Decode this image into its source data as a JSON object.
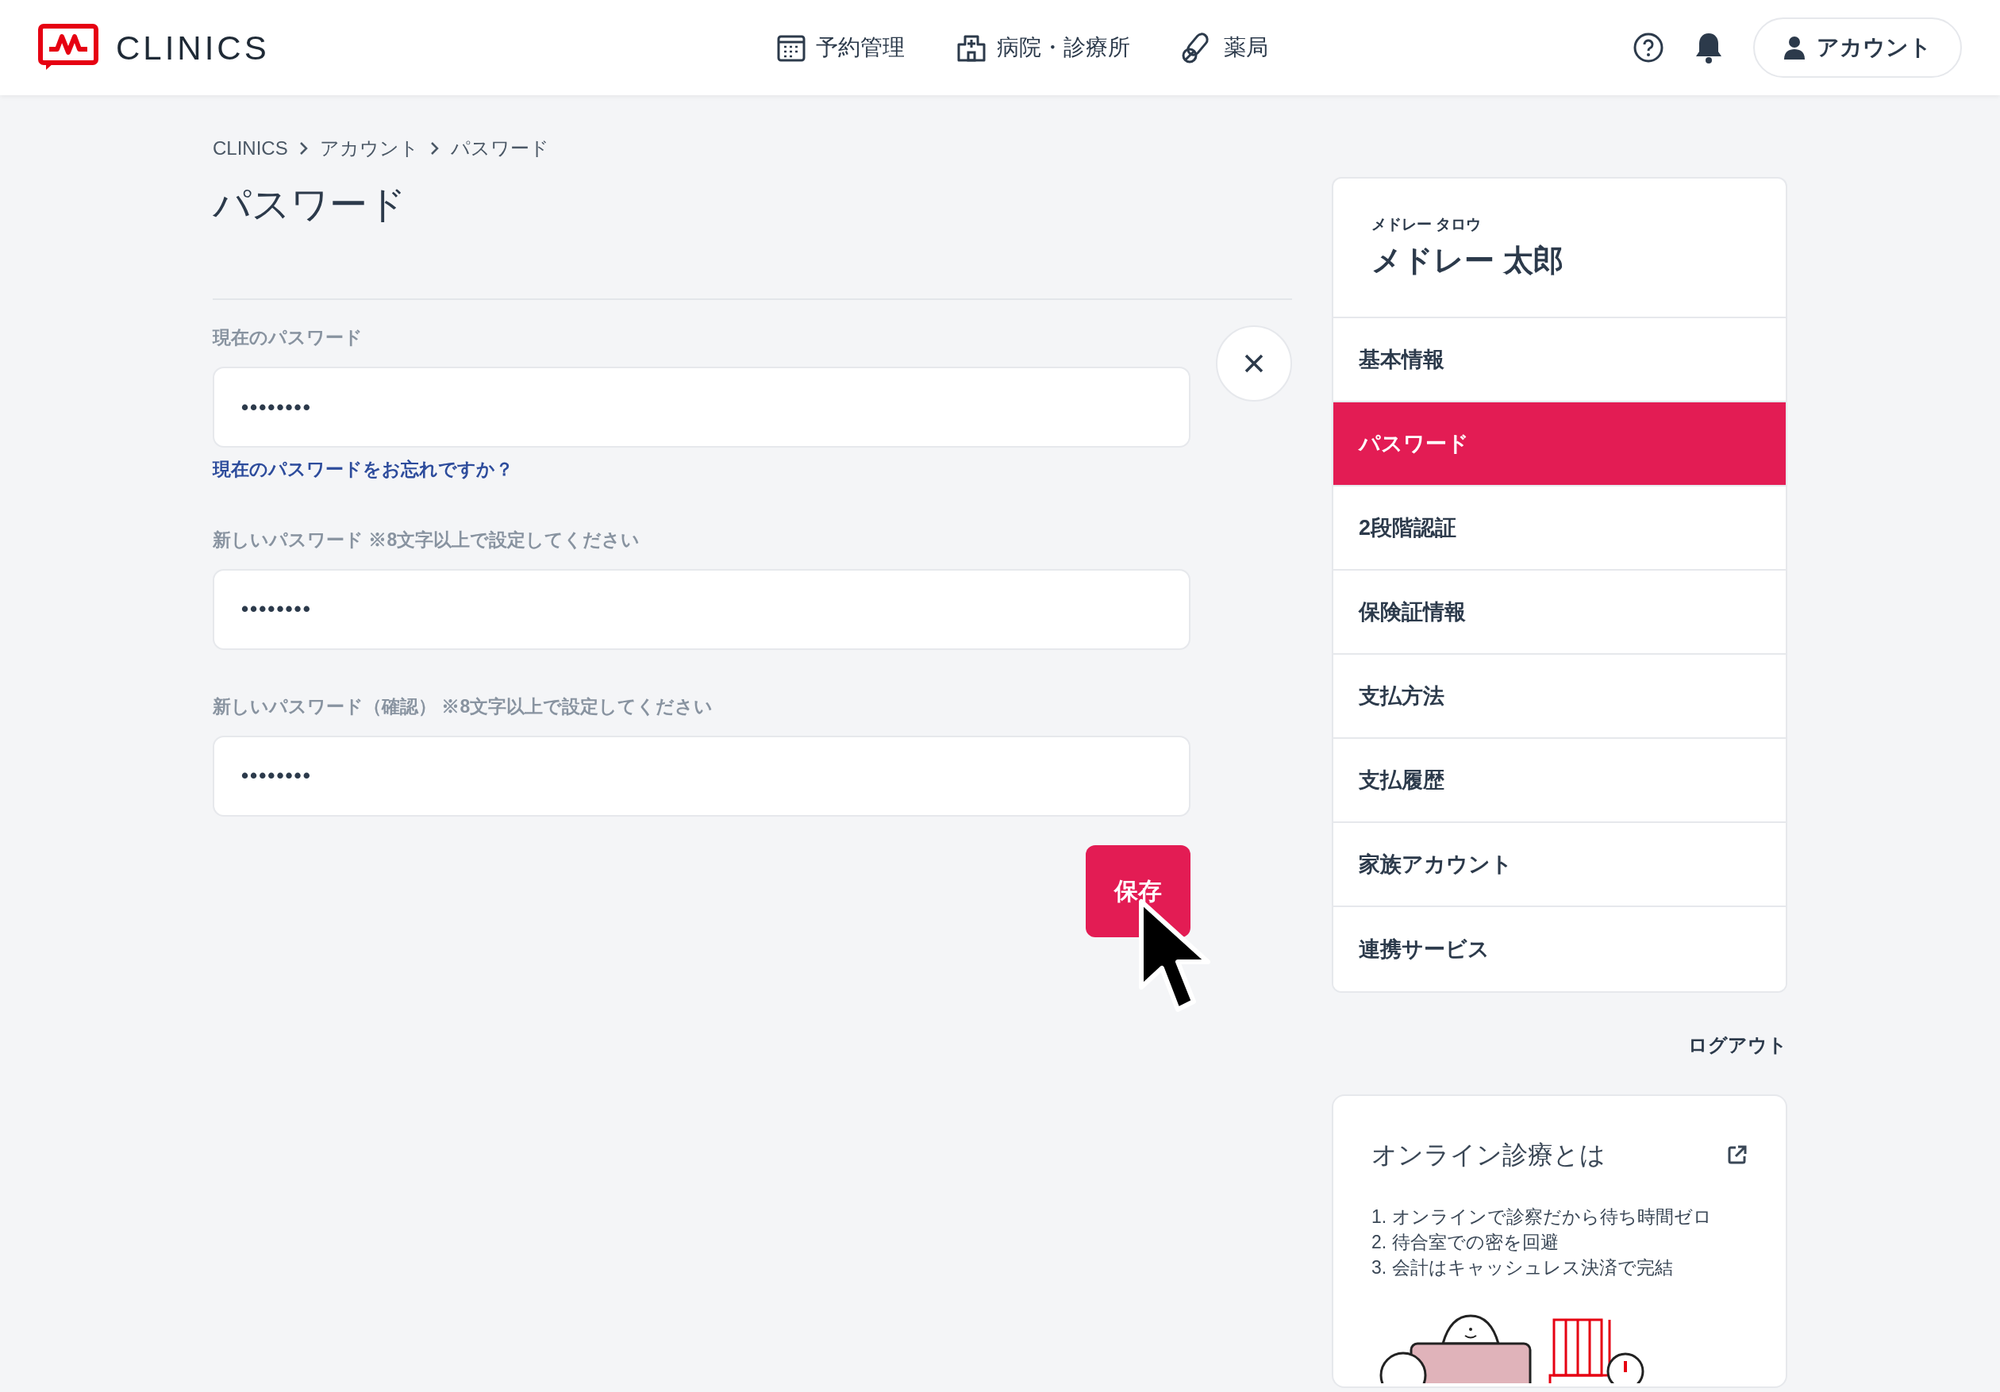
{
  "header": {
    "logo": "CLINICS",
    "nav": [
      {
        "label": "予約管理",
        "kind": "calendar"
      },
      {
        "label": "病院・診療所",
        "kind": "hospital"
      },
      {
        "label": "薬局",
        "kind": "pill"
      }
    ],
    "account_button": "アカウント"
  },
  "breadcrumb": [
    "CLINICS",
    "アカウント",
    "パスワード"
  ],
  "page_title": "パスワード",
  "form": {
    "fields": [
      {
        "label": "現在のパスワード",
        "value": "••••••••",
        "link": "現在のパスワードをお忘れですか？"
      },
      {
        "label": "新しいパスワード",
        "note": "※8文字以上で設定してください",
        "value": "••••••••"
      },
      {
        "label": "新しいパスワード（確認）",
        "note": "※8文字以上で設定してください",
        "value": "••••••••"
      }
    ],
    "save_button": "保存"
  },
  "profile": {
    "kana": "メドレー タロウ",
    "name": "メドレー 太郎"
  },
  "menu": [
    {
      "label": "基本情報",
      "selected": false
    },
    {
      "label": "パスワード",
      "selected": true
    },
    {
      "label": "2段階認証",
      "selected": false
    },
    {
      "label": "保険証情報",
      "selected": false
    },
    {
      "label": "支払方法",
      "selected": false
    },
    {
      "label": "支払履歴",
      "selected": false
    },
    {
      "label": "家族アカウント",
      "selected": false
    },
    {
      "label": "連携サービス",
      "selected": false
    }
  ],
  "logout": "ログアウト",
  "info_card": {
    "title": "オンライン診療とは",
    "items": [
      "1. オンラインで診察だから待ち時間ゼロ",
      "2. 待合室での密を回避",
      "3. 会計はキャッシュレス決済で完結"
    ]
  }
}
